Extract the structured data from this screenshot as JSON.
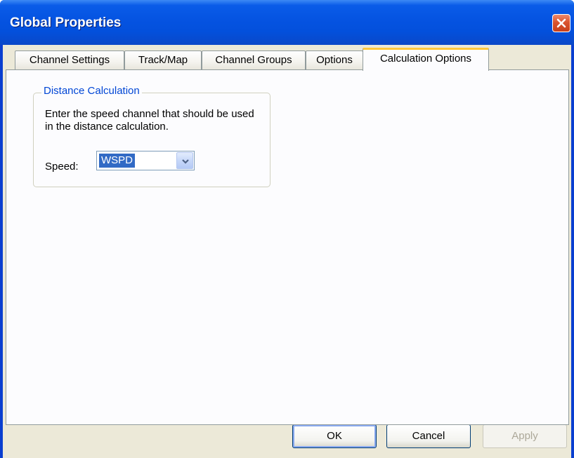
{
  "window": {
    "title": "Global Properties",
    "close_icon": "close-icon"
  },
  "tabs": [
    {
      "label": "Channel Settings",
      "active": false
    },
    {
      "label": "Track/Map",
      "active": false
    },
    {
      "label": "Channel Groups",
      "active": false
    },
    {
      "label": "Options",
      "active": false
    },
    {
      "label": "Calculation Options",
      "active": true
    }
  ],
  "distance_group": {
    "title": "Distance Calculation",
    "description": "Enter the speed channel that should be used in the distance calculation.",
    "speed_label": "Speed:",
    "speed_value": "WSPD",
    "dropdown_icon": "chevron-down-icon"
  },
  "buttons": {
    "ok": "OK",
    "cancel": "Cancel",
    "apply": "Apply"
  },
  "colors": {
    "titlebar": "#0553e1",
    "group_title": "#0046d5",
    "active_tab_accent": "#ffc83c",
    "selection": "#316ac5",
    "close_button": "#d9542f"
  }
}
